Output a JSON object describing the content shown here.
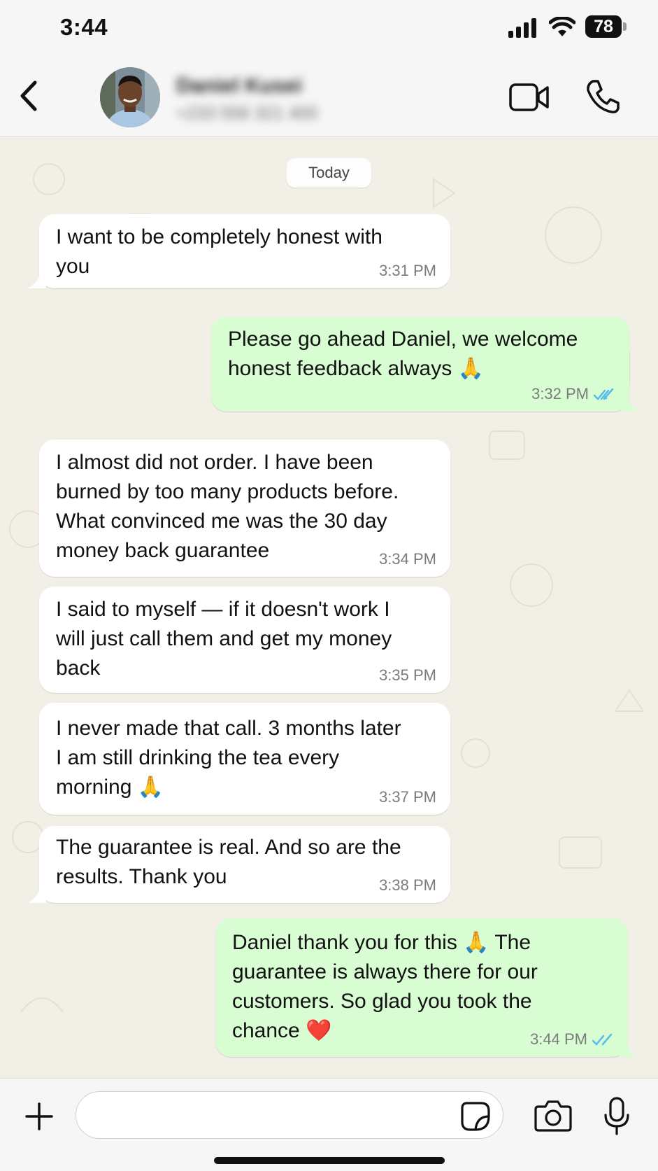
{
  "status_bar": {
    "time": "3:44",
    "battery": "78"
  },
  "header": {
    "contact_name": "Daniel Kusei",
    "contact_phone": "+233 556 321 400",
    "back_icon": "chevron-left-icon",
    "video_icon": "video-camera-icon",
    "call_icon": "phone-icon"
  },
  "chat": {
    "date_chip": "Today",
    "messages": [
      {
        "direction": "incoming",
        "text": "I want to be completely honest with\nyou",
        "time": "3:31 PM"
      },
      {
        "direction": "outgoing",
        "text": "Please go ahead Daniel, we welcome\nhonest feedback always 🙏",
        "time": "3:32 PM",
        "read": true
      },
      {
        "direction": "incoming",
        "text": "I almost did not order. I have been\nburned by too many products before.\nWhat convinced me was the 30 day\nmoney back guarantee",
        "time": "3:34 PM"
      },
      {
        "direction": "incoming",
        "text": "I said to myself — if it doesn't work I\nwill just call them and get my money\nback",
        "time": "3:35 PM"
      },
      {
        "direction": "incoming",
        "text": "I never made that call. 3 months later\nI am still drinking the tea every\nmorning 🙏",
        "time": "3:37 PM"
      },
      {
        "direction": "incoming",
        "text": "The guarantee is real. And so are the\nresults. Thank you",
        "time": "3:38 PM"
      },
      {
        "direction": "outgoing",
        "text": "Daniel thank you for this 🙏 The\nguarantee is always there for our\ncustomers. So glad you took the\nchance ❤️",
        "time": "3:44 PM",
        "read": true
      }
    ]
  },
  "input_bar": {
    "placeholder": "",
    "icons": [
      "plus-icon",
      "sticker-icon",
      "camera-icon",
      "microphone-icon"
    ]
  },
  "colors": {
    "incoming_bubble": "#ffffff",
    "outgoing_bubble": "#d9fdd3",
    "read_ticks": "#53bdeb",
    "chat_background": "#f2efe6"
  }
}
